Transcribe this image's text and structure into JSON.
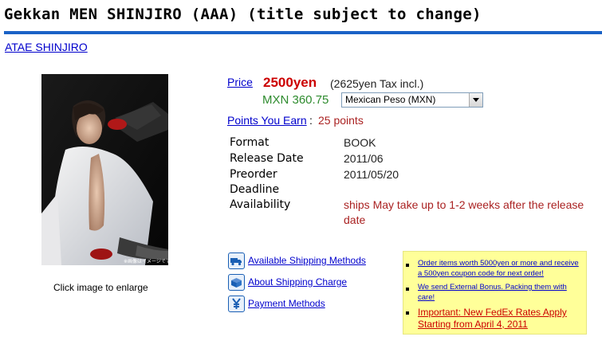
{
  "product": {
    "title": "Gekkan MEN SHINJIRO (AAA) (title subject to change)",
    "artist_link": "ATAE SHINJIRO",
    "image_caption": "Click image to enlarge",
    "photo_watermark": "※画像はイメージです。"
  },
  "pricing": {
    "price_label": "Price",
    "price_value": "2500yen",
    "tax_note": "(2625yen Tax incl.)",
    "converted_value": "MXN 360.75",
    "currency_selected": "Mexican Peso (MXN)",
    "points_label": "Points You Earn",
    "points_colon": ":",
    "points_value": "25 points"
  },
  "specs": [
    {
      "label": "Format",
      "value": "BOOK"
    },
    {
      "label": "Release Date",
      "value": "2011/06"
    },
    {
      "label": "Preorder Deadline",
      "value": "2011/05/20"
    },
    {
      "label": "Availability",
      "value": "ships May take up to 1-2 weeks after the release date"
    }
  ],
  "shipping_links": [
    {
      "label": "Available Shipping Methods",
      "icon": "truck-icon"
    },
    {
      "label": "About Shipping Charge",
      "icon": "package-icon"
    },
    {
      "label": "Payment Methods",
      "icon": "yen-icon"
    }
  ],
  "notices": [
    "Order items worth 5000yen or more and receive a 500yen coupon code for next order!",
    "We send External Bonus. Packing them with care!",
    "Important: New FedEx Rates Apply Starting from April 4, 2011"
  ],
  "colors": {
    "link": "#0000cc",
    "price_red": "#cc0000",
    "converted_green": "#2e8b2e",
    "title_rule": "#1a62c6",
    "notice_bg": "#ffff99"
  }
}
